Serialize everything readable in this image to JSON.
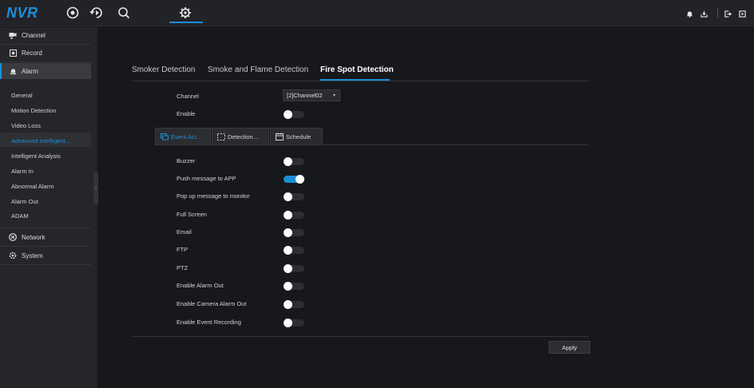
{
  "app": {
    "logo": "NVR"
  },
  "topnav": {
    "icons": [
      "live-view-icon",
      "playback-icon",
      "search-icon",
      "settings-icon"
    ],
    "right_icons": [
      "alarm-bell-icon",
      "download-icon",
      "logout-icon",
      "power-icon"
    ]
  },
  "sidebar": {
    "channel": "Channel",
    "record": "Record",
    "alarm": "Alarm",
    "sub_items": [
      "General",
      "Motion Detection",
      "Video Loss",
      "Advanced Intelligent…",
      "Intelligent Analysis",
      "Alarm In",
      "Abnormal Alarm",
      "Alarm Out",
      "ADAM"
    ],
    "active_sub_index": 3,
    "network": "Network",
    "system": "System"
  },
  "tabs": [
    "Smoker Detection",
    "Smoke and Flame Detection",
    "Fire Spot Detection"
  ],
  "active_tab_index": 2,
  "form": {
    "channel_label": "Channel",
    "channel_value": "[2]Channel02",
    "enable_label": "Enable",
    "enable_on": false
  },
  "subtabs": [
    "Event Act…",
    "Detection…",
    "Schedule"
  ],
  "active_subtab_index": 0,
  "actions": [
    {
      "label": "Buzzer",
      "on": false
    },
    {
      "label": "Push message to APP",
      "on": true
    },
    {
      "label": "Pop up message to monitor",
      "on": false
    },
    {
      "label": "Full Screen",
      "on": false
    },
    {
      "label": "Email",
      "on": false
    },
    {
      "label": "FTP",
      "on": false
    },
    {
      "label": "PTZ",
      "on": false
    },
    {
      "label": "Enable Alarm Out",
      "on": false
    },
    {
      "label": "Enable Camera Alarm Out",
      "on": false
    },
    {
      "label": "Enable Event Recording",
      "on": false
    }
  ],
  "apply_label": "Apply",
  "colors": {
    "accent": "#1c8fd9",
    "background": "#17181b",
    "sidebar": "#25262a"
  }
}
